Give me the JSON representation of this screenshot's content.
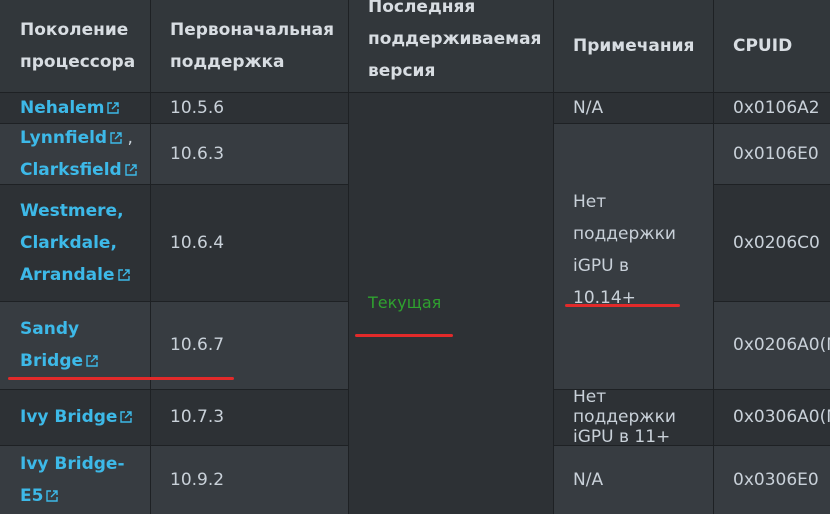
{
  "headers": {
    "generation": "Поколение процессора",
    "initial": "Первоначальная поддержка",
    "last": "Последняя поддерживаемая версия",
    "notes": "Примечания",
    "cpuid": "CPUID"
  },
  "rows": [
    {
      "gen": [
        "Nehalem"
      ],
      "initial": "10.5.6",
      "notes": "N/A",
      "cpuid": "0x0106A2"
    },
    {
      "gen": [
        "Lynnfield",
        "Clarksfield"
      ],
      "initial": "10.6.3",
      "cpuid": "0x0106E0"
    },
    {
      "gen": [
        "Westmere,",
        "Clarkdale,",
        "Arrandale"
      ],
      "initial": "10.6.4",
      "cpuid": "0x0206C0"
    },
    {
      "gen": [
        "Sandy",
        "Bridge"
      ],
      "initial": "10.6.7",
      "cpuid": "0x0206A0(M"
    },
    {
      "gen": [
        "Ivy Bridge"
      ],
      "initial": "10.7.3",
      "notes": "Нет поддержки iGPU в 11+",
      "cpuid": "0x0306A0(M"
    },
    {
      "gen": [
        "Ivy Bridge-",
        "E5"
      ],
      "initial": "10.9.2",
      "notes": "N/A",
      "cpuid": "0x0306E0"
    }
  ],
  "merged_last_version": "Текущая",
  "merged_note": [
    "Нет",
    "поддержки",
    "iGPU в",
    "10.14+"
  ],
  "separator_comma": ",",
  "icons": {
    "external_link": "external-link-icon"
  },
  "colors": {
    "link": "#3db9e8",
    "current": "#2fa12f",
    "annotation": "#e22a2a"
  }
}
